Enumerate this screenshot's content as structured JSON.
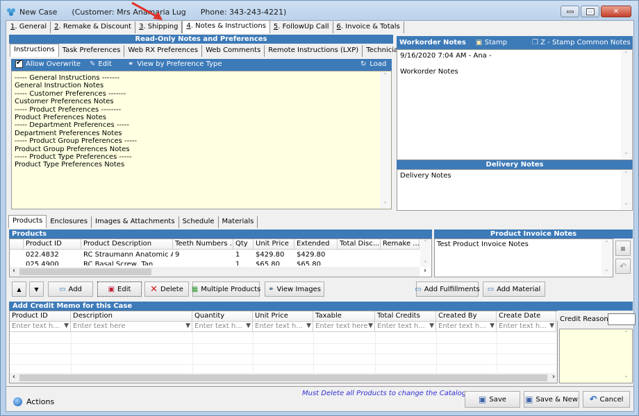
{
  "window": {
    "title": "New Case",
    "customer": "(Customer: Mrs Anamaria Lug",
    "phone": "Phone: 343-243-4221)",
    "min_glyph": "–",
    "max_glyph": "□",
    "close_glyph": "✕"
  },
  "main_tabs": [
    {
      "key": "1",
      "label": ". General"
    },
    {
      "key": "2",
      "label": ". Remake & Discount"
    },
    {
      "key": "3",
      "label": ". Shipping"
    },
    {
      "key": "4",
      "label": ". Notes & Instructions",
      "active": true
    },
    {
      "key": "5",
      "label": ". FollowUp Call"
    },
    {
      "key": "6",
      "label": ". Invoice & Totals"
    }
  ],
  "readonly_notes": {
    "header": "Read-Only Notes and Preferences",
    "tabs": [
      "Instructions",
      "Task Preferences",
      "Web RX Preferences",
      "Web Comments",
      "Remote Instructions (LXP)",
      "Technician Comments"
    ],
    "toolbar": {
      "allow_overwrite": "Allow Overwrite",
      "allow_overwrite_checked": true,
      "edit": "Edit",
      "view_by_pref": "View by Preference Type",
      "load": "Load"
    },
    "lines": [
      "----- General Instructions -------",
      "General Instruction Notes",
      "----- Customer Preferences -------",
      "Customer Preferences Notes",
      "----- Product Preferences --------",
      "Product Preferences Notes",
      "----- Department Preferences -----",
      "Department Preferences Notes",
      "----- Product Group Preferences -----",
      "Product Group Preferences Notes",
      "----- Product Type Preferences -----",
      "Product Type Preferences Notes"
    ]
  },
  "workorder_notes": {
    "header": "Workorder Notes",
    "stamp": "Stamp",
    "stamp_common": "Z - Stamp Common Notes",
    "line1": "9/16/2020 7:04 AM - Ana -",
    "line2": "Workorder Notes"
  },
  "delivery_notes": {
    "header": "Delivery Notes",
    "text": "Delivery Notes"
  },
  "lower_tabs": [
    "Products",
    "Enclosures",
    "Images & Attachments",
    "Schedule",
    "Materials"
  ],
  "products": {
    "header": "Products",
    "columns": [
      "Product ID",
      "Product Description",
      "Teeth Numbers ...",
      "Qty",
      "Unit Price",
      "Extended",
      "Total Disc...",
      "Remake ..."
    ],
    "rows": [
      [
        "022.4832",
        "RC Straumann Anatomic A...",
        "9",
        "1",
        "$429.80",
        "$429.80",
        "",
        ""
      ],
      [
        "025.4900",
        "RC Basal Screw, Tan",
        "",
        "1",
        "$65.80",
        "$65.80",
        "",
        ""
      ]
    ]
  },
  "product_invoice_notes": {
    "header": "Product Invoice Notes",
    "text": "Test Product Invoice Notes"
  },
  "product_buttons": {
    "up": "▲",
    "down": "▼",
    "add": "Add",
    "edit": "Edit",
    "delete": "Delete",
    "multiple": "Multiple Products",
    "view_images": "View Images",
    "add_fulfillments": "Add Fulfillments",
    "add_material": "Add Material"
  },
  "credit_memo": {
    "header": "Add Credit Memo for this Case",
    "columns": [
      "Product ID",
      "Description",
      "Quantity",
      "Unit Price",
      "Taxable",
      "Total Credits",
      "Created By",
      "Create Date"
    ],
    "filters": [
      "Enter text h...",
      "Enter text here",
      "Enter text h...",
      "Enter text h...",
      "Enter text here",
      "Enter text h...",
      "Enter text h...",
      "Enter text h..."
    ],
    "credit_reason_label": "Credit Reason:",
    "credit_reason_value": ""
  },
  "footer": {
    "actions": "Actions",
    "catalog_msg": "Must Delete all Products to change the Catalog",
    "save": "Save",
    "save_new": "Save & New",
    "cancel": "Cancel"
  }
}
